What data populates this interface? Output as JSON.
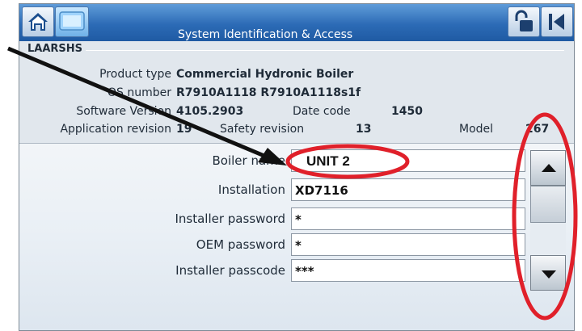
{
  "window": {
    "title": "System Identification & Access"
  },
  "toolbar": {
    "home_icon": "home-icon",
    "screen_icon": "monitor-icon",
    "lock_icon": "padlock-open-icon",
    "back_icon": "back-arrow-icon"
  },
  "identity": {
    "group_label": "LAARSHS",
    "product_type_label": "Product type",
    "product_type_value": "Commercial Hydronic Boiler",
    "os_number_label": "OS number",
    "os_number_value": "R7910A1118 R7910A1118s1f",
    "software_version_label": "Software Version",
    "software_version_value": "4105.2903",
    "date_code_label": "Date code",
    "date_code_value": "1450",
    "application_revision_label": "Application revision",
    "application_revision_value": "19",
    "safety_revision_label": "Safety revision",
    "safety_revision_value": "13",
    "model_label": "Model",
    "model_value": "267"
  },
  "fields": {
    "boiler_name_label": "Boiler name",
    "boiler_name_value": "UNIT 2",
    "installation_label": "Installation",
    "installation_value": "XD7116",
    "installer_password_label": "Installer password",
    "installer_password_value": "*",
    "oem_password_label": "OEM password",
    "oem_password_value": "*",
    "installer_passcode_label": "Installer passcode",
    "installer_passcode_value": "***"
  },
  "scrollbar": {
    "up_icon": "triangle-up-icon",
    "down_icon": "triangle-down-icon"
  },
  "annotation": {
    "color": "#e0202a",
    "arrow_color": "#111111"
  }
}
